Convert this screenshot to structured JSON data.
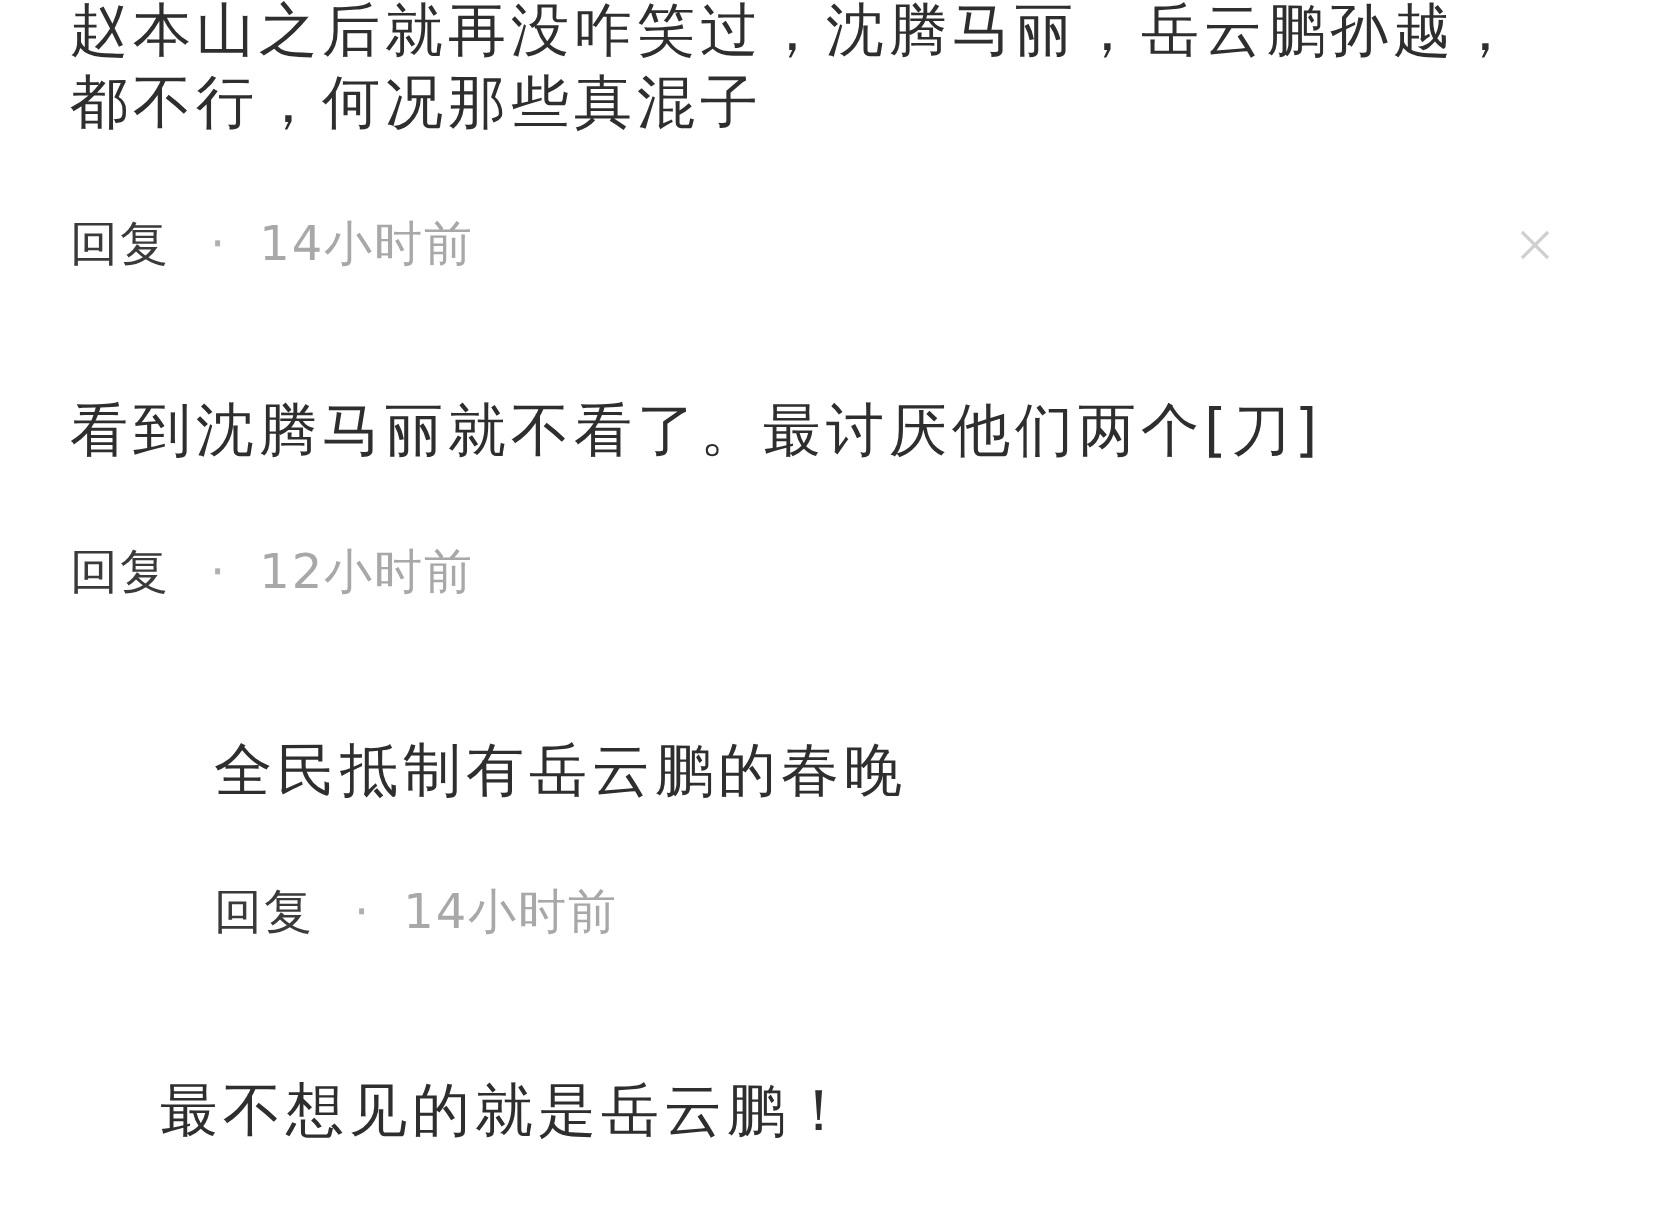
{
  "comments": [
    {
      "kind": "comment",
      "text": "赵本山之后就再没咋笑过，沈腾马丽，岳云鹏孙越，都不行，何况那些真混子",
      "reply": "回复",
      "separator": "·",
      "time": "14小时前",
      "closable": true
    },
    {
      "kind": "comment",
      "text": "看到沈腾马丽就不看了。最讨厌他们两个[刀]",
      "reply": "回复",
      "separator": "·",
      "time": "12小时前",
      "closable": false,
      "children": [
        {
          "kind": "comment",
          "text": "全民抵制有岳云鹏的春晚",
          "reply": "回复",
          "separator": "·",
          "time": "14小时前",
          "closable": false
        }
      ]
    },
    {
      "kind": "fragment",
      "text": "最不想见的就是岳云鹏！"
    }
  ]
}
